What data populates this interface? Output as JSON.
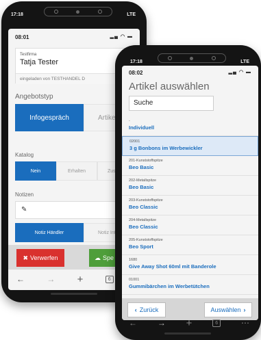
{
  "phone1": {
    "system": {
      "time": "17:18",
      "network": "LTE"
    },
    "status": {
      "time": "08:01",
      "icons": "signal-wifi-battery"
    },
    "customer": {
      "label": "Testfirma",
      "name": "Tatja Tester",
      "sub": "eingeladen von TESTHANDEL D"
    },
    "offer_type": {
      "label": "Angebotstyp",
      "options": [
        "Infogespräch",
        "Artike"
      ],
      "selected": "Infogespräch"
    },
    "catalog": {
      "label": "Katalog",
      "options": [
        "Nein",
        "Erhalten",
        "Zus"
      ],
      "selected": "Nein"
    },
    "notes": {
      "label": "Notizen",
      "options": [
        "Notiz Händler",
        "Notiz Inte"
      ],
      "selected": "Notiz Händler"
    },
    "actions": {
      "discard": "Verwerfen",
      "save": "Spe"
    }
  },
  "phone2": {
    "system": {
      "time": "17:18",
      "network": "LTE"
    },
    "status": {
      "time": "08:02",
      "icons": "signal-wifi-battery"
    },
    "title": "Artikel auswählen",
    "search": {
      "value": "Suche"
    },
    "items": [
      {
        "code": "-",
        "name": "Individuell",
        "selected": false
      },
      {
        "code": "02001",
        "name": "3 g Bonbons im Werbewickler",
        "selected": true
      },
      {
        "code": "201-Kunststoffspitze",
        "name": "Beo Basic",
        "selected": false
      },
      {
        "code": "202-Metallspitze",
        "name": "Beo Basic",
        "selected": false
      },
      {
        "code": "203-Kunststoffspitze",
        "name": "Beo Classic",
        "selected": false
      },
      {
        "code": "204-Metallspitze",
        "name": "Beo Classic",
        "selected": false
      },
      {
        "code": "205-Kunststoffspitze",
        "name": "Beo Sport",
        "selected": false
      },
      {
        "code": "1680",
        "name": "Give Away Shot 60ml mit Banderole",
        "selected": false
      },
      {
        "code": "01001",
        "name": "Gummibärchen im Werbetütchen",
        "selected": false
      }
    ],
    "actions": {
      "back": "Zurück",
      "select": "Auswählen"
    }
  },
  "colors": {
    "accent": "#1a6dbd",
    "danger": "#d9312e",
    "success": "#4e9e3a"
  }
}
